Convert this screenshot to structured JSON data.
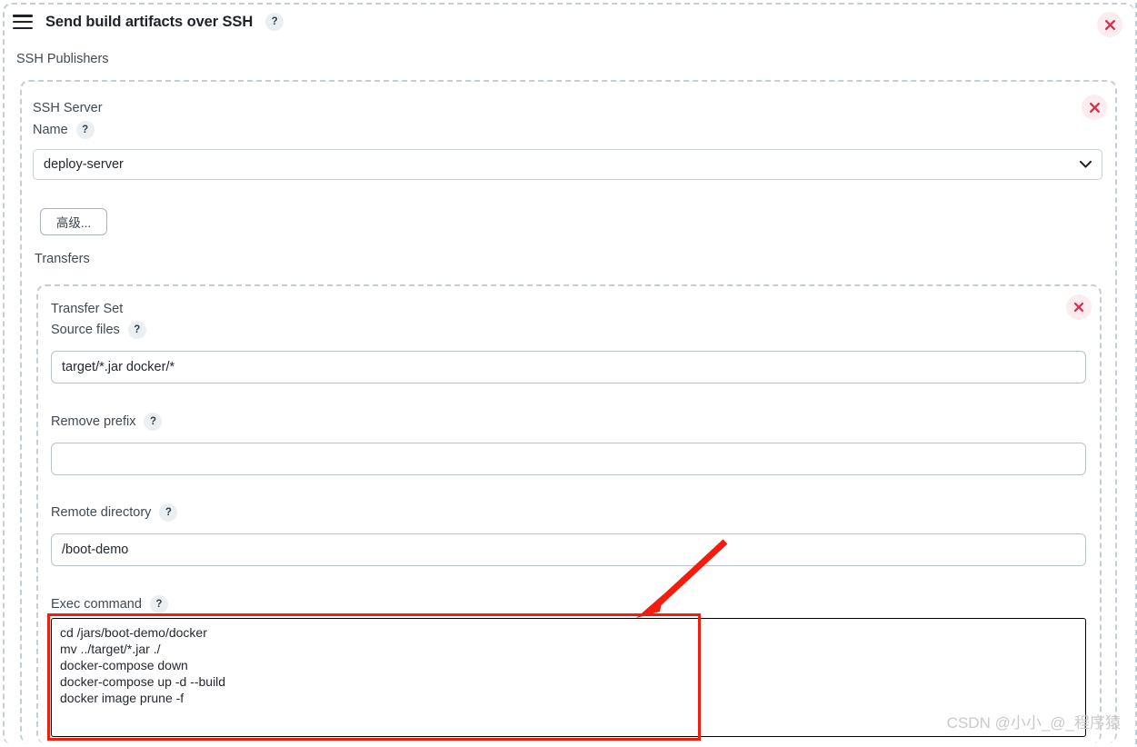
{
  "header": {
    "menu_icon": "hamburger-icon",
    "title": "Send build artifacts over SSH",
    "help": "?",
    "close_icon": "close-icon"
  },
  "publishers": {
    "section_label": "SSH Publishers",
    "close_icon": "close-icon"
  },
  "ssh_server": {
    "group_label": "SSH Server",
    "name_label": "Name",
    "help": "?",
    "selected": "deploy-server",
    "options": [
      "deploy-server"
    ],
    "chevron_icon": "chevron-down-icon",
    "advanced_button": "高级...",
    "transfers_label": "Transfers"
  },
  "transfer_set": {
    "group_label": "Transfer Set",
    "close_icon": "close-icon",
    "source_files": {
      "label": "Source files",
      "help": "?",
      "value": "target/*.jar docker/*",
      "placeholder": ""
    },
    "remove_prefix": {
      "label": "Remove prefix",
      "help": "?",
      "value": "",
      "placeholder": ""
    },
    "remote_directory": {
      "label": "Remote directory",
      "help": "?",
      "value": "/boot-demo",
      "placeholder": ""
    },
    "exec_command": {
      "label": "Exec command",
      "help": "?",
      "value": "cd /jars/boot-demo/docker\nmv ../target/*.jar ./\ndocker-compose down\ndocker-compose up -d --build\ndocker image prune -f",
      "placeholder": ""
    }
  },
  "annotation": {
    "arrow_icon": "red-arrow-icon",
    "highlight_color": "#f41c0c"
  },
  "watermark": "CSDN @小小_@_程序猿",
  "colors": {
    "accent_red": "#f41c0c",
    "close_red": "#d9304a",
    "close_bg": "#fdecef",
    "dashed_border": "#c3ced6",
    "text": "#404a52"
  }
}
